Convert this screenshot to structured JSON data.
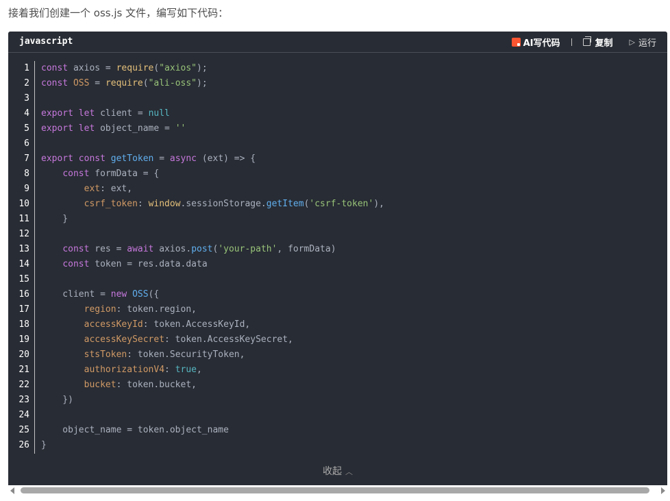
{
  "intro_text": "接着我们创建一个 oss.js 文件，编写如下代码：",
  "code_block": {
    "language": "javascript",
    "toolbar": {
      "ai_label": "AI写代码",
      "copy_label": "复制",
      "run_label": "运行"
    },
    "collapse_label": "收起",
    "lines": [
      [
        [
          "k",
          "const"
        ],
        [
          "t",
          " axios = "
        ],
        [
          "p",
          "require"
        ],
        [
          "t",
          "("
        ],
        [
          "s",
          "\"axios\""
        ],
        [
          "t",
          ");"
        ]
      ],
      [
        [
          "k",
          "const"
        ],
        [
          "t",
          " "
        ],
        [
          "pr",
          "OSS"
        ],
        [
          "t",
          " = "
        ],
        [
          "p",
          "require"
        ],
        [
          "t",
          "("
        ],
        [
          "s",
          "\"ali-oss\""
        ],
        [
          "t",
          ");"
        ]
      ],
      [],
      [
        [
          "k",
          "export"
        ],
        [
          "t",
          " "
        ],
        [
          "k",
          "let"
        ],
        [
          "t",
          " client = "
        ],
        [
          "c",
          "null"
        ]
      ],
      [
        [
          "k",
          "export"
        ],
        [
          "t",
          " "
        ],
        [
          "k",
          "let"
        ],
        [
          "t",
          " object_name = "
        ],
        [
          "s",
          "''"
        ]
      ],
      [],
      [
        [
          "k",
          "export"
        ],
        [
          "t",
          " "
        ],
        [
          "k",
          "const"
        ],
        [
          "t",
          " "
        ],
        [
          "f",
          "getToken"
        ],
        [
          "t",
          " = "
        ],
        [
          "k",
          "async"
        ],
        [
          "t",
          " (ext) => {"
        ]
      ],
      [
        [
          "t",
          "    "
        ],
        [
          "k",
          "const"
        ],
        [
          "t",
          " formData = {"
        ]
      ],
      [
        [
          "t",
          "        "
        ],
        [
          "pr",
          "ext"
        ],
        [
          "t",
          ": ext,"
        ]
      ],
      [
        [
          "t",
          "        "
        ],
        [
          "pr",
          "csrf_token"
        ],
        [
          "t",
          ": "
        ],
        [
          "p",
          "window"
        ],
        [
          "t",
          ".sessionStorage."
        ],
        [
          "f",
          "getItem"
        ],
        [
          "t",
          "("
        ],
        [
          "s",
          "'csrf-token'"
        ],
        [
          "t",
          "),"
        ]
      ],
      [
        [
          "t",
          "    }"
        ]
      ],
      [],
      [
        [
          "t",
          "    "
        ],
        [
          "k",
          "const"
        ],
        [
          "t",
          " res = "
        ],
        [
          "k",
          "await"
        ],
        [
          "t",
          " axios."
        ],
        [
          "f",
          "post"
        ],
        [
          "t",
          "("
        ],
        [
          "s",
          "'your-path'"
        ],
        [
          "t",
          ", formData)"
        ]
      ],
      [
        [
          "t",
          "    "
        ],
        [
          "k",
          "const"
        ],
        [
          "t",
          " token = res.data.data"
        ]
      ],
      [],
      [
        [
          "t",
          "    client = "
        ],
        [
          "k",
          "new"
        ],
        [
          "t",
          " "
        ],
        [
          "f",
          "OSS"
        ],
        [
          "t",
          "({"
        ]
      ],
      [
        [
          "t",
          "        "
        ],
        [
          "pr",
          "region"
        ],
        [
          "t",
          ": token.region,"
        ]
      ],
      [
        [
          "t",
          "        "
        ],
        [
          "pr",
          "accessKeyId"
        ],
        [
          "t",
          ": token.AccessKeyId,"
        ]
      ],
      [
        [
          "t",
          "        "
        ],
        [
          "pr",
          "accessKeySecret"
        ],
        [
          "t",
          ": token.AccessKeySecret,"
        ]
      ],
      [
        [
          "t",
          "        "
        ],
        [
          "pr",
          "stsToken"
        ],
        [
          "t",
          ": token.SecurityToken,"
        ]
      ],
      [
        [
          "t",
          "        "
        ],
        [
          "pr",
          "authorizationV4"
        ],
        [
          "t",
          ": "
        ],
        [
          "c",
          "true"
        ],
        [
          "t",
          ","
        ]
      ],
      [
        [
          "t",
          "        "
        ],
        [
          "pr",
          "bucket"
        ],
        [
          "t",
          ": token.bucket,"
        ]
      ],
      [
        [
          "t",
          "    })"
        ]
      ],
      [],
      [
        [
          "t",
          "    object_name = token.object_name"
        ]
      ],
      [
        [
          "t",
          "}"
        ]
      ]
    ]
  }
}
